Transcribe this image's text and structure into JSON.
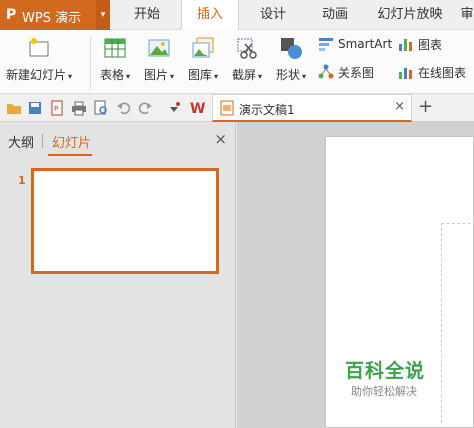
{
  "app": {
    "logo": "P",
    "name": "WPS 演示",
    "menu_caret": "▾"
  },
  "tabs": [
    {
      "label": "开始"
    },
    {
      "label": "插入"
    },
    {
      "label": "设计"
    },
    {
      "label": "动画"
    },
    {
      "label": "幻灯片放映"
    },
    {
      "label": "审"
    }
  ],
  "ribbon": {
    "new_slide": "新建幻灯片",
    "table": "表格",
    "picture": "图片",
    "gallery": "图库",
    "screenshot": "截屏",
    "shape": "形状",
    "smartart": "SmartArt",
    "chart": "图表",
    "relation": "关系图",
    "online_chart": "在线图表",
    "caret": "▾"
  },
  "document": {
    "tab_title": "演示文稿1",
    "close": "×",
    "new_tab": "+"
  },
  "panel": {
    "tab_outline": "大纲",
    "tab_slides": "幻灯片",
    "close": "×",
    "slide_number": "1"
  },
  "watermark": {
    "main": "百科全说",
    "sub": "助你轻松解决"
  },
  "colors": {
    "accent": "#d2691e",
    "watermark": "#3aa34a"
  }
}
